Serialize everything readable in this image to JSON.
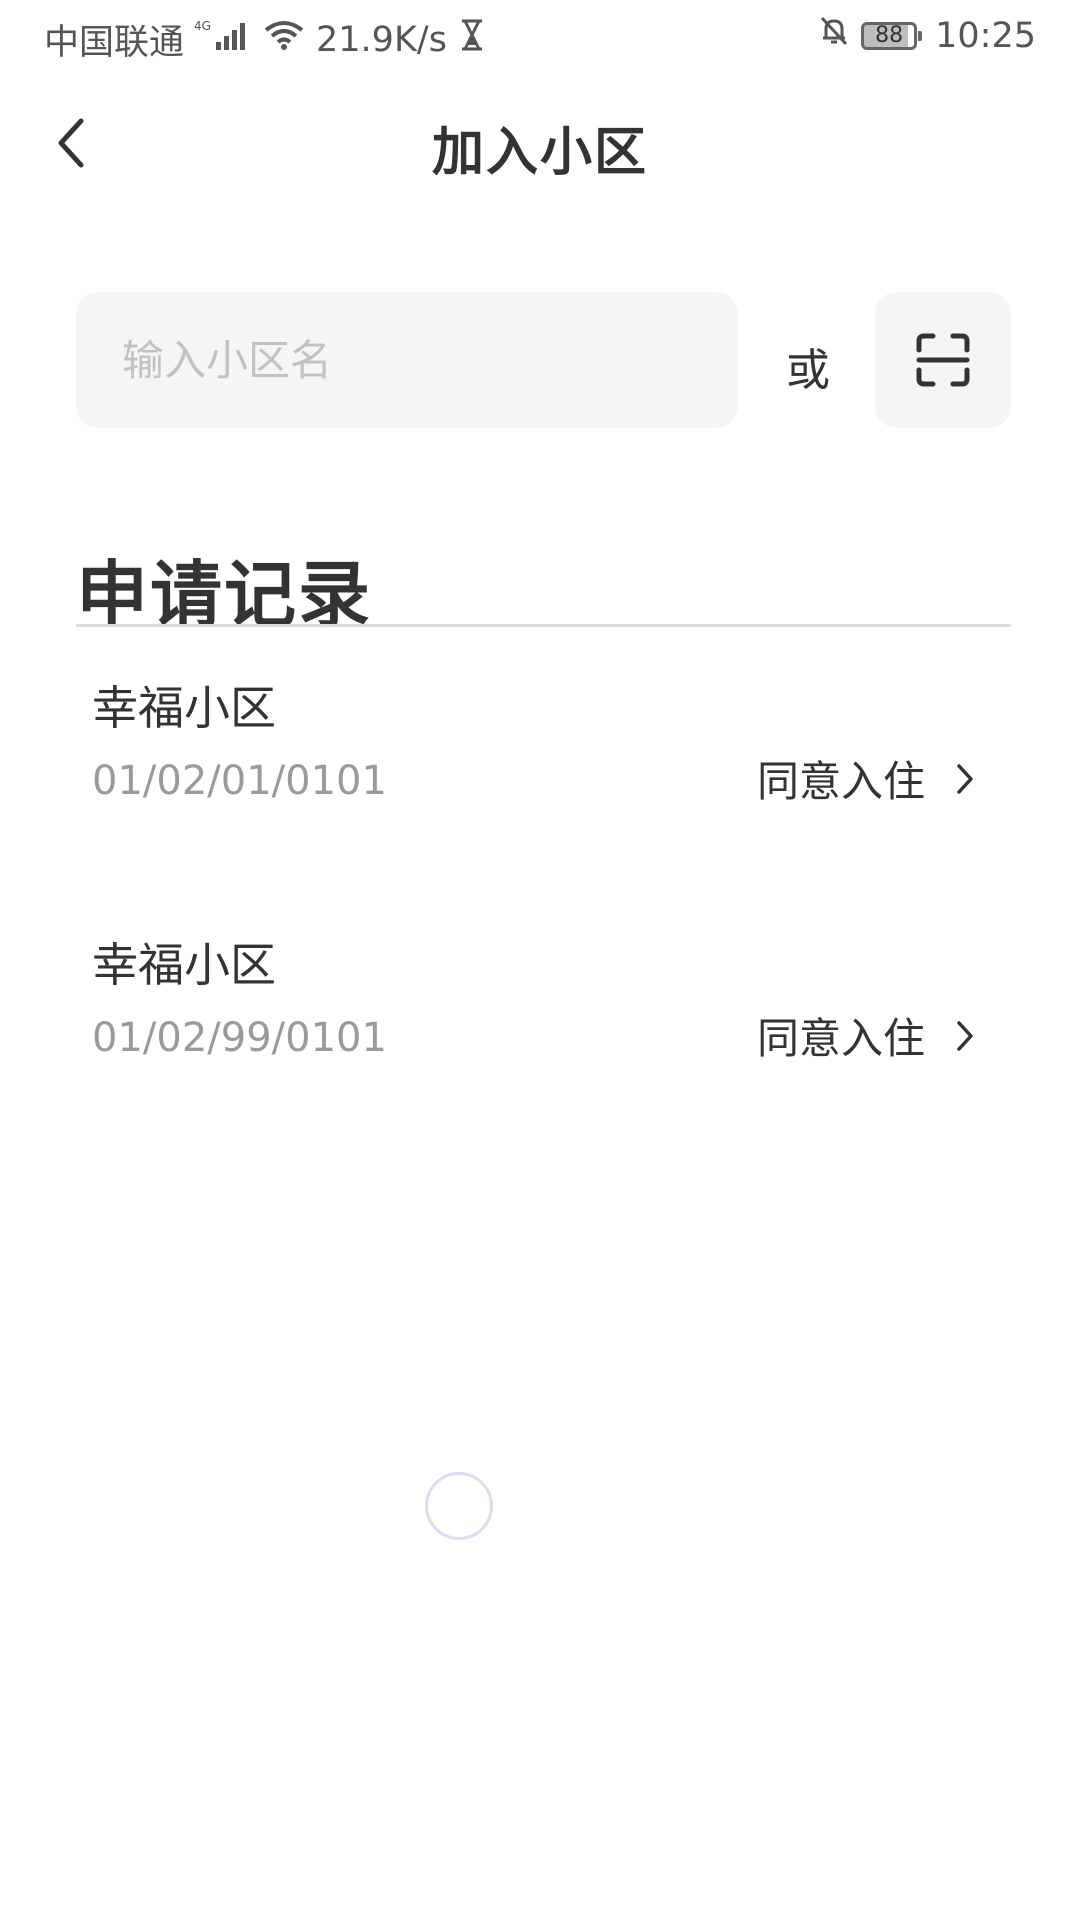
{
  "status_bar": {
    "carrier": "中国联通",
    "network": "4G",
    "speed": "21.9K/s",
    "battery": "88",
    "time": "10:25"
  },
  "header": {
    "title": "加入小区"
  },
  "search": {
    "placeholder": "输入小区名",
    "or_label": "或"
  },
  "records": {
    "title": "申请记录",
    "items": [
      {
        "name": "幸福小区",
        "address": "01/02/01/0101",
        "status": "同意入住"
      },
      {
        "name": "幸福小区",
        "address": "01/02/99/0101",
        "status": "同意入住"
      }
    ]
  }
}
